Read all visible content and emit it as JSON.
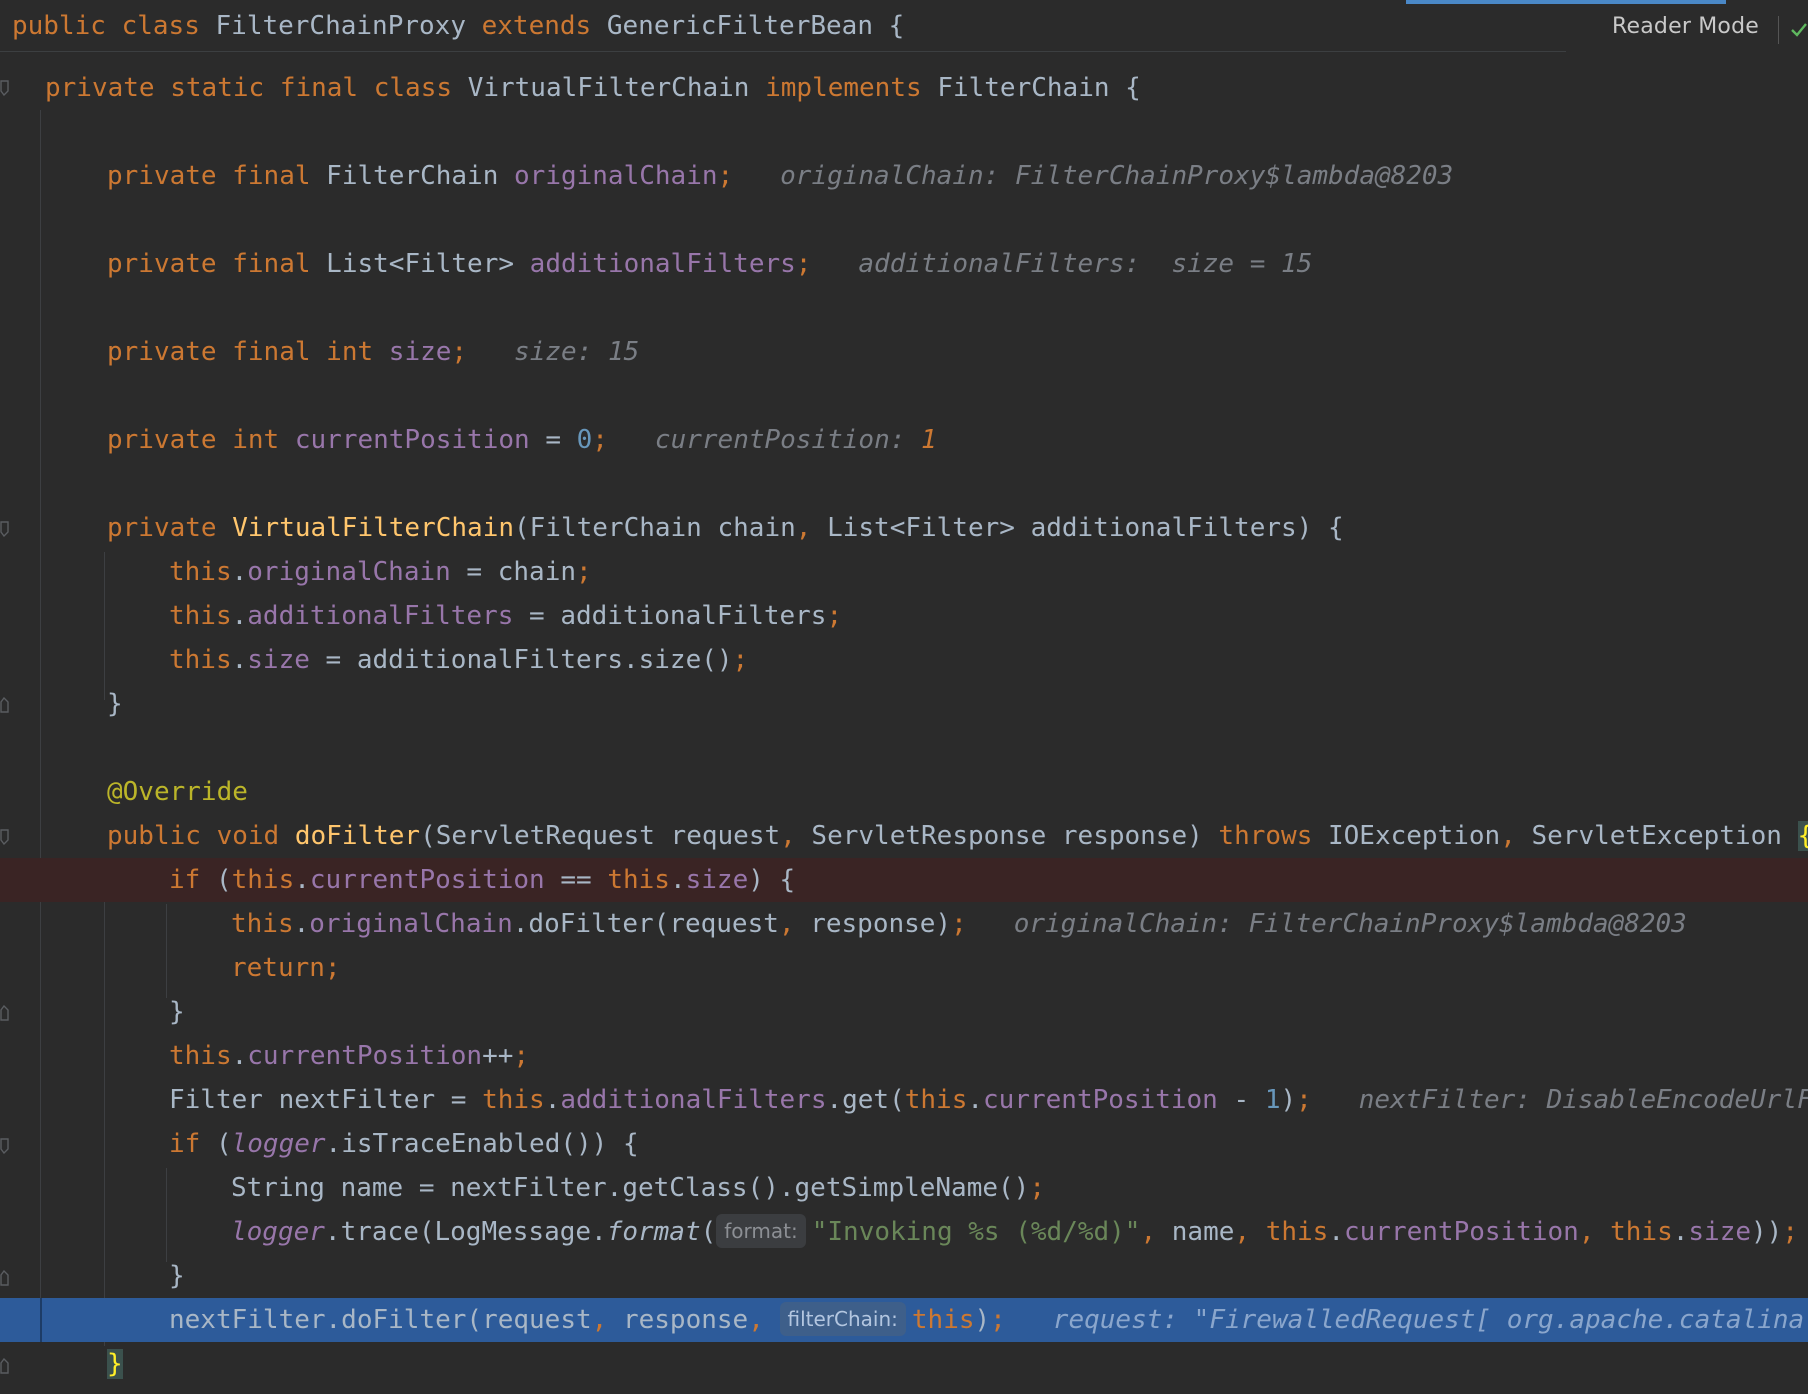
{
  "sticky": {
    "kw1": "public",
    "kw2": "class",
    "name": "FilterChainProxy",
    "kw3": "extends",
    "parent": "GenericFilterBean",
    "brace": "{"
  },
  "toolbar": {
    "reader_mode": "Reader Mode",
    "status_icon": "check-icon"
  },
  "code": {
    "l1": {
      "kw1": "private",
      "kw2": "static",
      "kw3": "final",
      "kw4": "class",
      "name": "VirtualFilterChain",
      "kw5": "implements",
      "iface": "FilterChain",
      "brace": "{"
    },
    "l2": {
      "kw1": "private",
      "kw2": "final",
      "type": "FilterChain",
      "field": "originalChain",
      "semi": ";",
      "hint": "originalChain: FilterChainProxy$lambda@8203"
    },
    "l3": {
      "kw1": "private",
      "kw2": "final",
      "type": "List<Filter>",
      "field": "additionalFilters",
      "semi": ";",
      "hint": "additionalFilters:  size = 15"
    },
    "l4": {
      "kw1": "private",
      "kw2": "final",
      "kw3": "int",
      "field": "size",
      "semi": ";",
      "hint": "size: 15"
    },
    "l5": {
      "kw1": "private",
      "kw2": "int",
      "field": "currentPosition",
      "op": " = ",
      "num": "0",
      "semi": ";",
      "hint": "currentPosition: ",
      "hint_val": "1"
    },
    "l6": {
      "kw1": "private",
      "fn": "VirtualFilterChain",
      "p1": "(FilterChain chain",
      "comma": ",",
      "p2": " List<Filter> additionalFilters) {"
    },
    "l7": {
      "this": "this",
      "dot": ".",
      "field": "originalChain",
      "rest": " = chain",
      "semi": ";"
    },
    "l8": {
      "this": "this",
      "dot": ".",
      "field": "additionalFilters",
      "rest": " = additionalFilters",
      "semi": ";"
    },
    "l9": {
      "this": "this",
      "dot": ".",
      "field": "size",
      "rest": " = additionalFilters.size()",
      "semi": ";"
    },
    "l10": {
      "text": "}"
    },
    "l11": {
      "text": "@Override"
    },
    "l12": {
      "kw1": "public",
      "kw2": "void",
      "fn": "doFilter",
      "p1": "(ServletRequest request",
      "comma1": ",",
      "p2": " ServletResponse response) ",
      "kw3": "throws",
      "p3": " IOException",
      "comma2": ",",
      "p4": " ServletException ",
      "brace": "{"
    },
    "l13": {
      "kw1": "if",
      "p1": " (",
      "this1": "this",
      "dot1": ".",
      "field1": "currentPosition",
      "op": " == ",
      "this2": "this",
      "dot2": ".",
      "field2": "size",
      "rest": ") {"
    },
    "l14": {
      "this": "this",
      "dot": ".",
      "field": "originalChain",
      "rest": ".doFilter(request",
      "comma": ",",
      "rest2": " response)",
      "semi": ";",
      "hint": "originalChain: FilterChainProxy$lambda@8203"
    },
    "l15": {
      "kw": "return",
      "semi": ";"
    },
    "l16": {
      "text": "}"
    },
    "l17": {
      "this": "this",
      "dot": ".",
      "field": "currentPosition",
      "rest": "++",
      "semi": ";"
    },
    "l18": {
      "p1": "Filter nextFilter = ",
      "this1": "this",
      "dot1": ".",
      "field1": "additionalFilters",
      "p2": ".get(",
      "this2": "this",
      "dot2": ".",
      "field2": "currentPosition",
      "p3": " - ",
      "num": "1",
      "p4": ")",
      "semi": ";",
      "hint": "nextFilter: DisableEncodeUrlFi"
    },
    "l19": {
      "kw": "if",
      "p1": " (",
      "logger": "logger",
      "rest": ".isTraceEnabled()) {"
    },
    "l20": {
      "p1": "String name = nextFilter.getClass().getSimpleName()",
      "semi": ";"
    },
    "l21": {
      "logger": "logger",
      "p1": ".trace(LogMessage.",
      "fmt": "format",
      "p2": "(",
      "param": "format:",
      "str": "\"Invoking %s (%d/%d)\"",
      "comma1": ",",
      "p3": " name",
      "comma2": ",",
      "sp1": " ",
      "this1": "this",
      "dot1": ".",
      "field1": "currentPosition",
      "comma3": ",",
      "sp2": " ",
      "this2": "this",
      "dot2": ".",
      "field2": "size",
      "p4": "))",
      "semi": ";"
    },
    "l22": {
      "text": "}"
    },
    "l23": {
      "p1": "nextFilter.doFilter(request",
      "comma1": ",",
      "p2": " response",
      "comma2": ",",
      "sp": " ",
      "param": "filterChain:",
      "this": "this",
      "p3": ")",
      "semi": ";",
      "hint": "request: \"FirewalledRequest[ org.apache.catalina"
    },
    "l24": {
      "text": "}"
    }
  }
}
